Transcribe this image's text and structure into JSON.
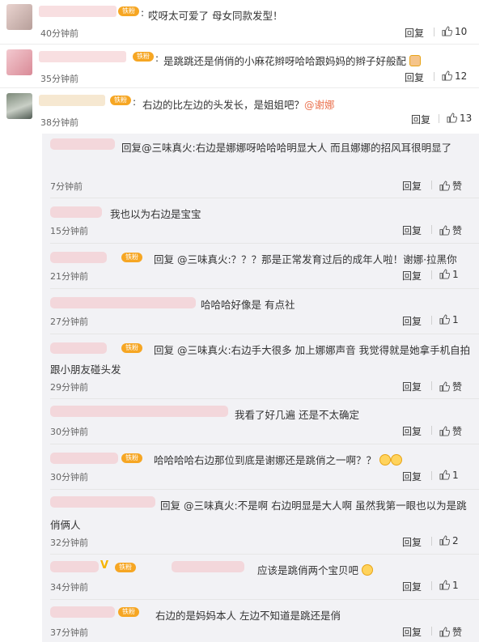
{
  "colors": {
    "vip_badge": "#f6a623",
    "mention": "#eb7350",
    "subpanel_bg": "#f2f2f5"
  },
  "top_comments": [
    {
      "badge": "铁粉",
      "text": "哎呀太可爱了 母女同款发型！",
      "time": "40分钟前",
      "reply": "回复",
      "likes": "10"
    },
    {
      "badge": "铁粉",
      "text": "是跳跳还是俏俏的小麻花辫呀哈哈跟妈妈的辫子好般配",
      "time": "35分钟前",
      "reply": "回复",
      "likes": "12"
    },
    {
      "badge": "铁粉",
      "text": "右边的比左边的头发长，是姐姐吧？",
      "mention": "@谢娜",
      "time": "38分钟前",
      "reply": "回复",
      "likes": "13"
    }
  ],
  "replies": [
    {
      "badge": "",
      "text": "回复@三味真火:右边是娜娜呀哈哈哈明显大人 而且娜娜的招风耳很明显了",
      "time": "7分钟前",
      "reply": "回复",
      "likes": "赞"
    },
    {
      "badge": "",
      "text": "我也以为右边是宝宝",
      "time": "15分钟前",
      "reply": "回复",
      "likes": "赞"
    },
    {
      "badge": "铁粉",
      "text": "回复 @三味真火:？？？那是正常发育过后的成年人啦！谢娜·拉黑你",
      "time": "21分钟前",
      "reply": "回复",
      "likes": "1"
    },
    {
      "badge": "",
      "text": "哈哈哈好像是 有点社",
      "time": "27分钟前",
      "reply": "回复",
      "likes": "1"
    },
    {
      "badge": "铁粉",
      "text": "回复 @三味真火:右边手大很多 加上娜娜声音 我觉得就是她拿手机自拍跟小朋友碰头发",
      "time": "29分钟前",
      "reply": "回复",
      "likes": "赞"
    },
    {
      "badge": "",
      "text": "我看了好几遍 还是不太确定",
      "time": "30分钟前",
      "reply": "回复",
      "likes": "赞"
    },
    {
      "badge": "铁粉",
      "text": "哈哈哈哈右边那位到底是谢娜还是跳俏之一啊？？",
      "time": "30分钟前",
      "reply": "回复",
      "likes": "1"
    },
    {
      "badge": "",
      "text": "回复 @三味真火:不是啊 右边明显是大人啊 虽然我第一眼也以为是跳俏俩人",
      "time": "32分钟前",
      "reply": "回复",
      "likes": "2"
    },
    {
      "badge": "铁粉",
      "text": "应该是跳俏两个宝贝吧",
      "time": "34分钟前",
      "reply": "回复",
      "likes": "1"
    },
    {
      "badge": "铁粉",
      "text": "右边的是妈妈本人 左边不知道是跳还是俏",
      "time": "37分钟前",
      "reply": "回复",
      "likes": "赞"
    }
  ]
}
